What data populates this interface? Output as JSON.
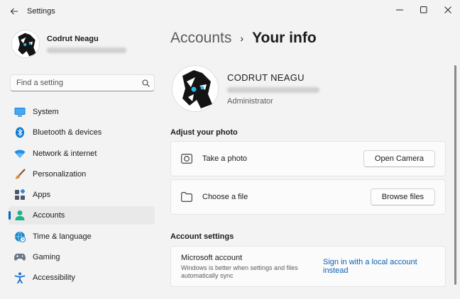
{
  "window": {
    "title": "Settings"
  },
  "sidebar": {
    "profile_name": "Codrut Neagu",
    "search_placeholder": "Find a setting",
    "items": [
      {
        "label": "System",
        "icon": "monitor-icon",
        "color": "#0a78d4"
      },
      {
        "label": "Bluetooth & devices",
        "icon": "bluetooth-icon",
        "color": "#0a78d4"
      },
      {
        "label": "Network & internet",
        "icon": "wifi-icon",
        "color": "#1e8ee6"
      },
      {
        "label": "Personalization",
        "icon": "brush-icon",
        "color": "#d27a2c"
      },
      {
        "label": "Apps",
        "icon": "apps-icon",
        "color": "#4a5868"
      },
      {
        "label": "Accounts",
        "icon": "person-icon",
        "color": "#1eb38b",
        "active": true
      },
      {
        "label": "Time & language",
        "icon": "globe-clock-icon",
        "color": "#1a86c8"
      },
      {
        "label": "Gaming",
        "icon": "gamepad-icon",
        "color": "#6b7785"
      },
      {
        "label": "Accessibility",
        "icon": "accessibility-icon",
        "color": "#1a6fd1"
      }
    ]
  },
  "main": {
    "breadcrumb": {
      "parent": "Accounts",
      "separator": "›",
      "current": "Your info"
    },
    "user": {
      "name": "CODRUT NEAGU",
      "role": "Administrator"
    },
    "photo_section": {
      "title": "Adjust your photo",
      "take_photo": {
        "label": "Take a photo",
        "button": "Open Camera",
        "icon": "camera-icon"
      },
      "choose_file": {
        "label": "Choose a file",
        "button": "Browse files",
        "icon": "folder-icon"
      }
    },
    "account_settings": {
      "title": "Account settings",
      "microsoft_account": {
        "title": "Microsoft account",
        "description": "Windows is better when settings and files automatically sync",
        "link": "Sign in with a local account instead"
      }
    }
  },
  "colors": {
    "accent": "#0067c0",
    "link": "#0a5fb4"
  }
}
